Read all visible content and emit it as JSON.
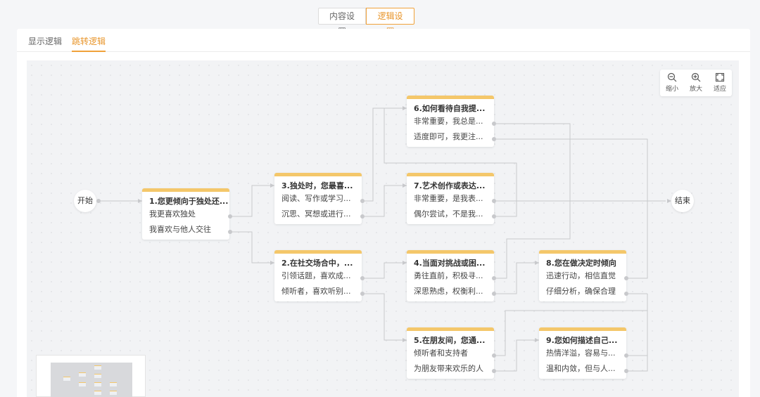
{
  "top_tabs": [
    {
      "label": "内容设置",
      "active": false
    },
    {
      "label": "逻辑设置",
      "active": true
    }
  ],
  "sub_tabs": [
    {
      "label": "显示逻辑",
      "active": false
    },
    {
      "label": "跳转逻辑",
      "active": true
    }
  ],
  "start_label": "开始",
  "end_label": "结束",
  "zoom": {
    "out_label": "缩小",
    "in_label": "放大",
    "fit_label": "适应"
  },
  "nodes": {
    "q1": {
      "title": "1.您更倾向于独处还...",
      "options": [
        "我更喜欢独处",
        "我喜欢与他人交往"
      ]
    },
    "q2": {
      "title": "2.在社交场合中，...",
      "options": [
        "引领话题，喜欢成...",
        "倾听者，喜欢听别..."
      ]
    },
    "q3": {
      "title": "3.独处时，您最喜...",
      "options": [
        "阅读、写作或学习...",
        "沉思、冥想或进行..."
      ]
    },
    "q4": {
      "title": "4.当面对挑战或困...",
      "options": [
        "勇往直前，积极寻...",
        "深思熟虑，权衡利..."
      ]
    },
    "q5": {
      "title": "5.在朋友间，您通...",
      "options": [
        "倾听者和支持者",
        "为朋友带来欢乐的人"
      ]
    },
    "q6": {
      "title": "6.如何看待自我提...",
      "options": [
        "非常重要，我总是...",
        "适度即可，我更注..."
      ]
    },
    "q7": {
      "title": "7.艺术创作或表达...",
      "options": [
        "非常重要，是我表...",
        "偶尔尝试，不是我..."
      ]
    },
    "q8": {
      "title": "8.您在做决定时倾向",
      "options": [
        "迅速行动，相信直觉",
        "仔细分析，确保合理"
      ]
    },
    "q9": {
      "title": "9.您如何描述自己...",
      "options": [
        "热情洋溢，容易与...",
        "温和内敛，但与人..."
      ]
    }
  },
  "colors": {
    "accent": "#f0a23a",
    "node_header": "#f4c76a",
    "edge": "#c8c9cc"
  }
}
